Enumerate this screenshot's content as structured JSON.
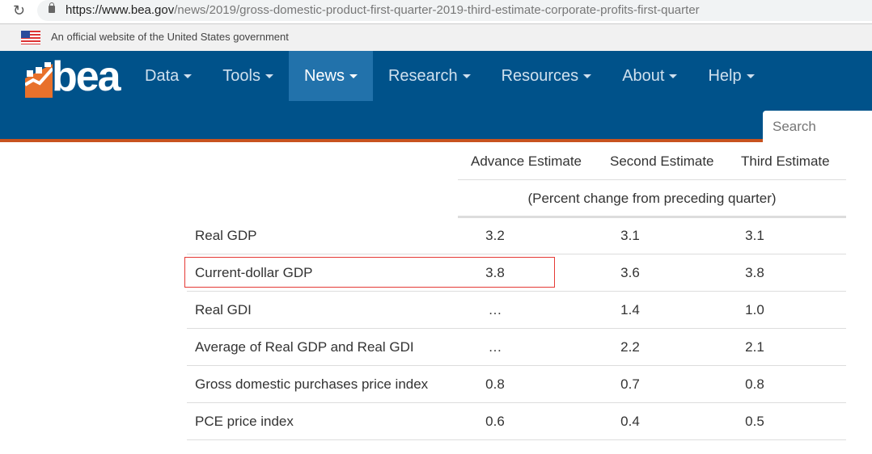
{
  "browser": {
    "url_host": "https://www.bea.gov",
    "url_path": "/news/2019/gross-domestic-product-first-quarter-2019-third-estimate-corporate-profits-first-quarter"
  },
  "gov_banner": "An official website of the United States government",
  "logo": "bea",
  "nav": {
    "items": [
      {
        "label": "Data"
      },
      {
        "label": "Tools"
      },
      {
        "label": "News",
        "active": true
      },
      {
        "label": "Research"
      },
      {
        "label": "Resources"
      },
      {
        "label": "About"
      },
      {
        "label": "Help"
      }
    ],
    "search_placeholder": "Search"
  },
  "colors": {
    "nav": "#00528a",
    "active": "#2272ab",
    "accent": "#c8531f",
    "highlight": "#e53935"
  },
  "table": {
    "headers": [
      "Advance Estimate",
      "Second Estimate",
      "Third Estimate"
    ],
    "subheader": "(Percent change from preceding quarter)",
    "rows": [
      {
        "label": "Real GDP",
        "values": [
          "3.2",
          "3.1",
          "3.1"
        ]
      },
      {
        "label": "Current-dollar GDP",
        "values": [
          "3.8",
          "3.6",
          "3.8"
        ],
        "highlighted": true
      },
      {
        "label": "Real GDI",
        "values": [
          "…",
          "1.4",
          "1.0"
        ]
      },
      {
        "label": "Average of Real GDP and Real GDI",
        "values": [
          "…",
          "2.2",
          "2.1"
        ]
      },
      {
        "label": "Gross domestic purchases price index",
        "values": [
          "0.8",
          "0.7",
          "0.8"
        ]
      },
      {
        "label": "PCE price index",
        "values": [
          "0.6",
          "0.4",
          "0.5"
        ]
      }
    ]
  }
}
